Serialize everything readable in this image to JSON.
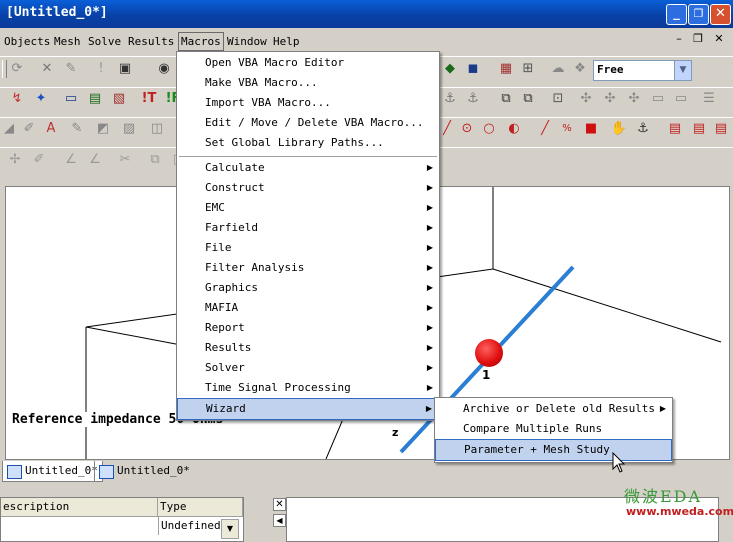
{
  "window": {
    "title": "[Untitled_0*]",
    "minimize": "_",
    "restore": "❐",
    "close": "✕"
  },
  "menubar": {
    "items": [
      "Objects",
      "Mesh",
      "Solve",
      "Results",
      "Macros",
      "Window",
      "Help"
    ],
    "mdi": [
      "–",
      "❐",
      "✕"
    ]
  },
  "toolbar": {
    "mode_value": "Free",
    "icons": [
      "refresh-icon",
      "delete-icon",
      "flag-icon",
      "alert-icon",
      "select-icon",
      "view-icon"
    ]
  },
  "macros_menu": {
    "items": [
      {
        "label": "Open VBA Macro Editor",
        "submenu": false
      },
      {
        "label": "Make VBA Macro...",
        "submenu": false
      },
      {
        "label": "Import VBA Macro...",
        "submenu": false
      },
      {
        "label": "Edit / Move / Delete VBA Macro...",
        "submenu": false
      },
      {
        "label": "Set Global Library Paths...",
        "submenu": false
      },
      {
        "label": "Calculate",
        "submenu": true
      },
      {
        "label": "Construct",
        "submenu": true
      },
      {
        "label": "EMC",
        "submenu": true
      },
      {
        "label": "Farfield",
        "submenu": true
      },
      {
        "label": "File",
        "submenu": true
      },
      {
        "label": "Filter Analysis",
        "submenu": true
      },
      {
        "label": "Graphics",
        "submenu": true
      },
      {
        "label": "MAFIA",
        "submenu": true
      },
      {
        "label": "Report",
        "submenu": true
      },
      {
        "label": "Results",
        "submenu": true
      },
      {
        "label": "Solver",
        "submenu": true
      },
      {
        "label": "Time Signal Processing",
        "submenu": true
      },
      {
        "label": "Wizard",
        "submenu": true
      }
    ],
    "arrow": "▶"
  },
  "wizard_menu": {
    "items": [
      {
        "label": "Archive or Delete old Results",
        "submenu": true
      },
      {
        "label": "Compare Multiple Runs",
        "submenu": false
      },
      {
        "label": "Parameter + Mesh Study",
        "submenu": false
      }
    ]
  },
  "viewport": {
    "reference_label": "Reference impedance   50 Ohms",
    "port_number": "1",
    "axis_z": "z"
  },
  "tabs": [
    "Untitled_0*",
    "Untitled_0*"
  ],
  "bottom_panel": {
    "columns": [
      "escription",
      "Type"
    ],
    "row_type": "Undefined"
  },
  "watermark": {
    "logo": "微波EDA",
    "site": "www.mweda.com"
  },
  "colors": {
    "title_bar": "#0842a8",
    "menu_highlight": "#c1d2ee",
    "wire": "#2a7fd4",
    "port": "#e01010"
  }
}
